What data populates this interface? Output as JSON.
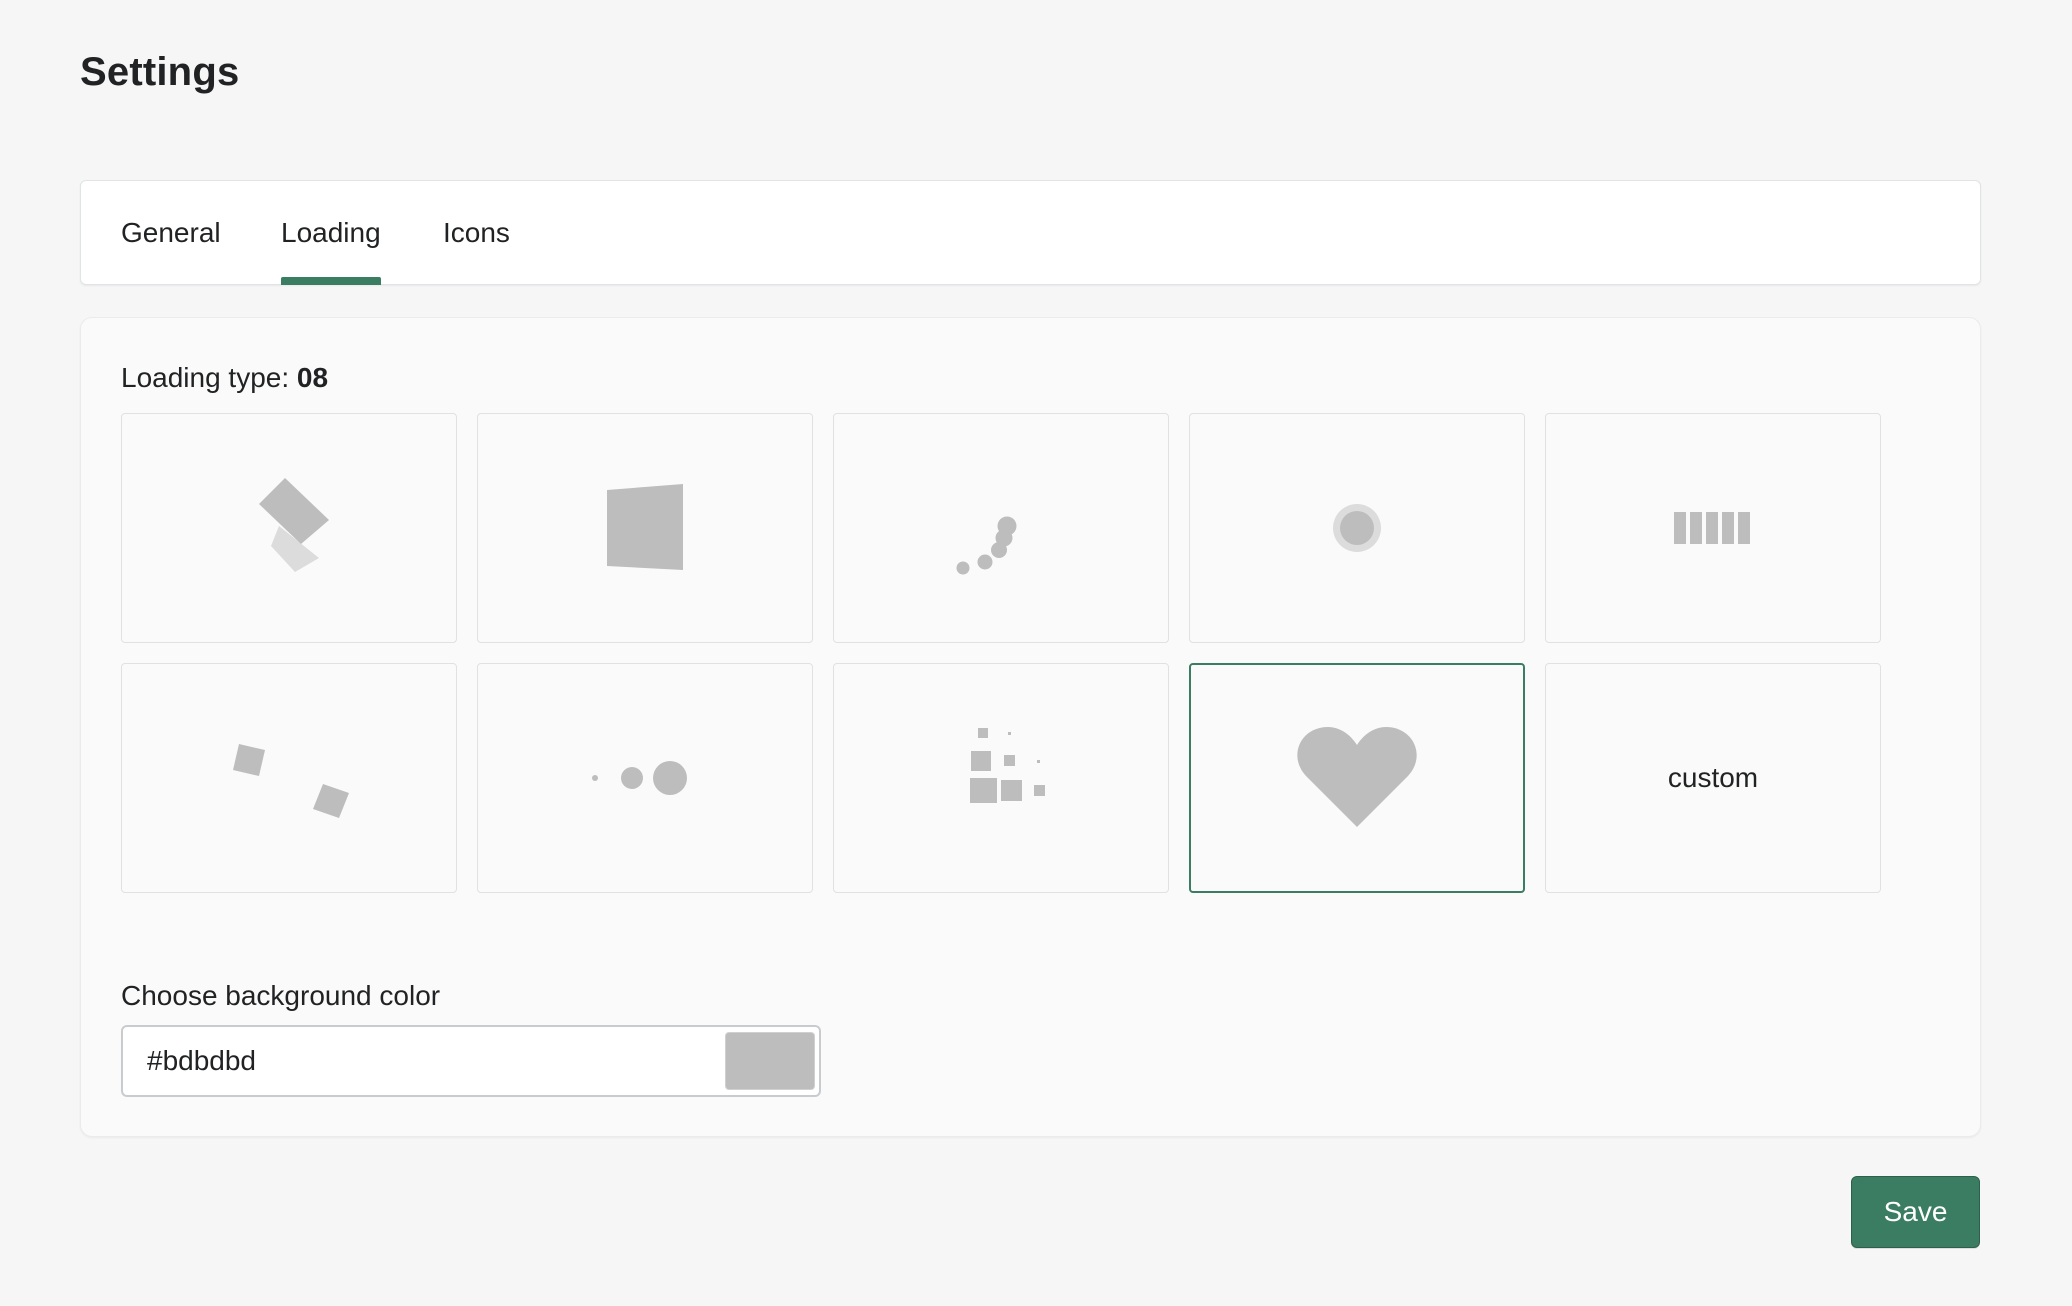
{
  "page": {
    "title": "Settings"
  },
  "tabs": [
    {
      "label": "General",
      "active": false
    },
    {
      "label": "Loading",
      "active": true
    },
    {
      "label": "Icons",
      "active": false
    }
  ],
  "loading": {
    "label_prefix": "Loading type: ",
    "selected_type": "08",
    "options": [
      {
        "id": "01",
        "icon": "rotating-square-icon"
      },
      {
        "id": "02",
        "icon": "flipping-square-icon"
      },
      {
        "id": "03",
        "icon": "spiral-dots-icon"
      },
      {
        "id": "04",
        "icon": "pulsing-circle-icon"
      },
      {
        "id": "05",
        "icon": "bars-icon"
      },
      {
        "id": "06",
        "icon": "orbiting-squares-icon"
      },
      {
        "id": "07",
        "icon": "growing-dots-icon"
      },
      {
        "id": "08",
        "icon": "scattered-squares-icon"
      },
      {
        "id": "09",
        "icon": "heart-icon",
        "selected": true
      },
      {
        "id": "10",
        "label": "custom"
      }
    ]
  },
  "background": {
    "label": "Choose background color",
    "value": "#bdbdbd"
  },
  "colors": {
    "accent": "#3b7d62",
    "icon_gray": "#bdbdbd"
  },
  "actions": {
    "save_label": "Save"
  }
}
